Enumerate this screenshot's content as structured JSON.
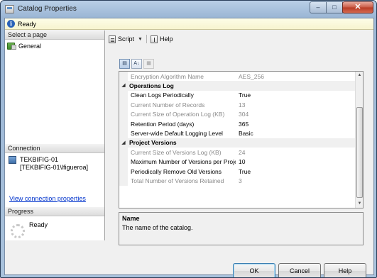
{
  "window": {
    "title": "Catalog Properties"
  },
  "title_buttons": {
    "minimize": "–",
    "maximize": "□",
    "close": "✕"
  },
  "status": {
    "text": "Ready"
  },
  "left": {
    "select_page_header": "Select a page",
    "pages": [
      {
        "label": "General"
      }
    ],
    "connection_header": "Connection",
    "server": "TEKBIFIG-01",
    "user": "[TEKBIFIG-01\\lfigueroa]",
    "connection_link": "View connection properties",
    "progress_header": "Progress",
    "progress_status": "Ready"
  },
  "toolbar": {
    "script_label": "Script",
    "help_label": "Help"
  },
  "propbar": {
    "categorized": "▤",
    "alphabetical": "A↓",
    "pages": "▦"
  },
  "grid": {
    "rows": [
      {
        "type": "prop",
        "readonly": true,
        "name": "Encryption Algorithm Name",
        "value": "AES_256"
      },
      {
        "type": "category",
        "name": "Operations Log"
      },
      {
        "type": "prop",
        "readonly": false,
        "name": "Clean Logs Periodically",
        "value": "True"
      },
      {
        "type": "prop",
        "readonly": true,
        "name": "Current Number of Records",
        "value": "13"
      },
      {
        "type": "prop",
        "readonly": true,
        "name": "Current Size of Operation Log (KB)",
        "value": "304"
      },
      {
        "type": "prop",
        "readonly": false,
        "name": "Retention Period (days)",
        "value": "365"
      },
      {
        "type": "prop",
        "readonly": false,
        "name": "Server-wide Default Logging Level",
        "value": "Basic"
      },
      {
        "type": "category",
        "name": "Project Versions"
      },
      {
        "type": "prop",
        "readonly": true,
        "name": "Current Size of Versions Log (KB)",
        "value": "24"
      },
      {
        "type": "prop",
        "readonly": false,
        "name": "Maximum Number of Versions per Proje",
        "value": "10"
      },
      {
        "type": "prop",
        "readonly": false,
        "name": "Periodically Remove Old Versions",
        "value": "True"
      },
      {
        "type": "prop",
        "readonly": true,
        "name": "Total Number of Versions Retained",
        "value": "3"
      }
    ],
    "scroll_up": "▲",
    "scroll_down": "▼"
  },
  "description": {
    "title": "Name",
    "text": "The name of the catalog."
  },
  "buttons": {
    "ok": "OK",
    "cancel": "Cancel",
    "help": "Help"
  }
}
